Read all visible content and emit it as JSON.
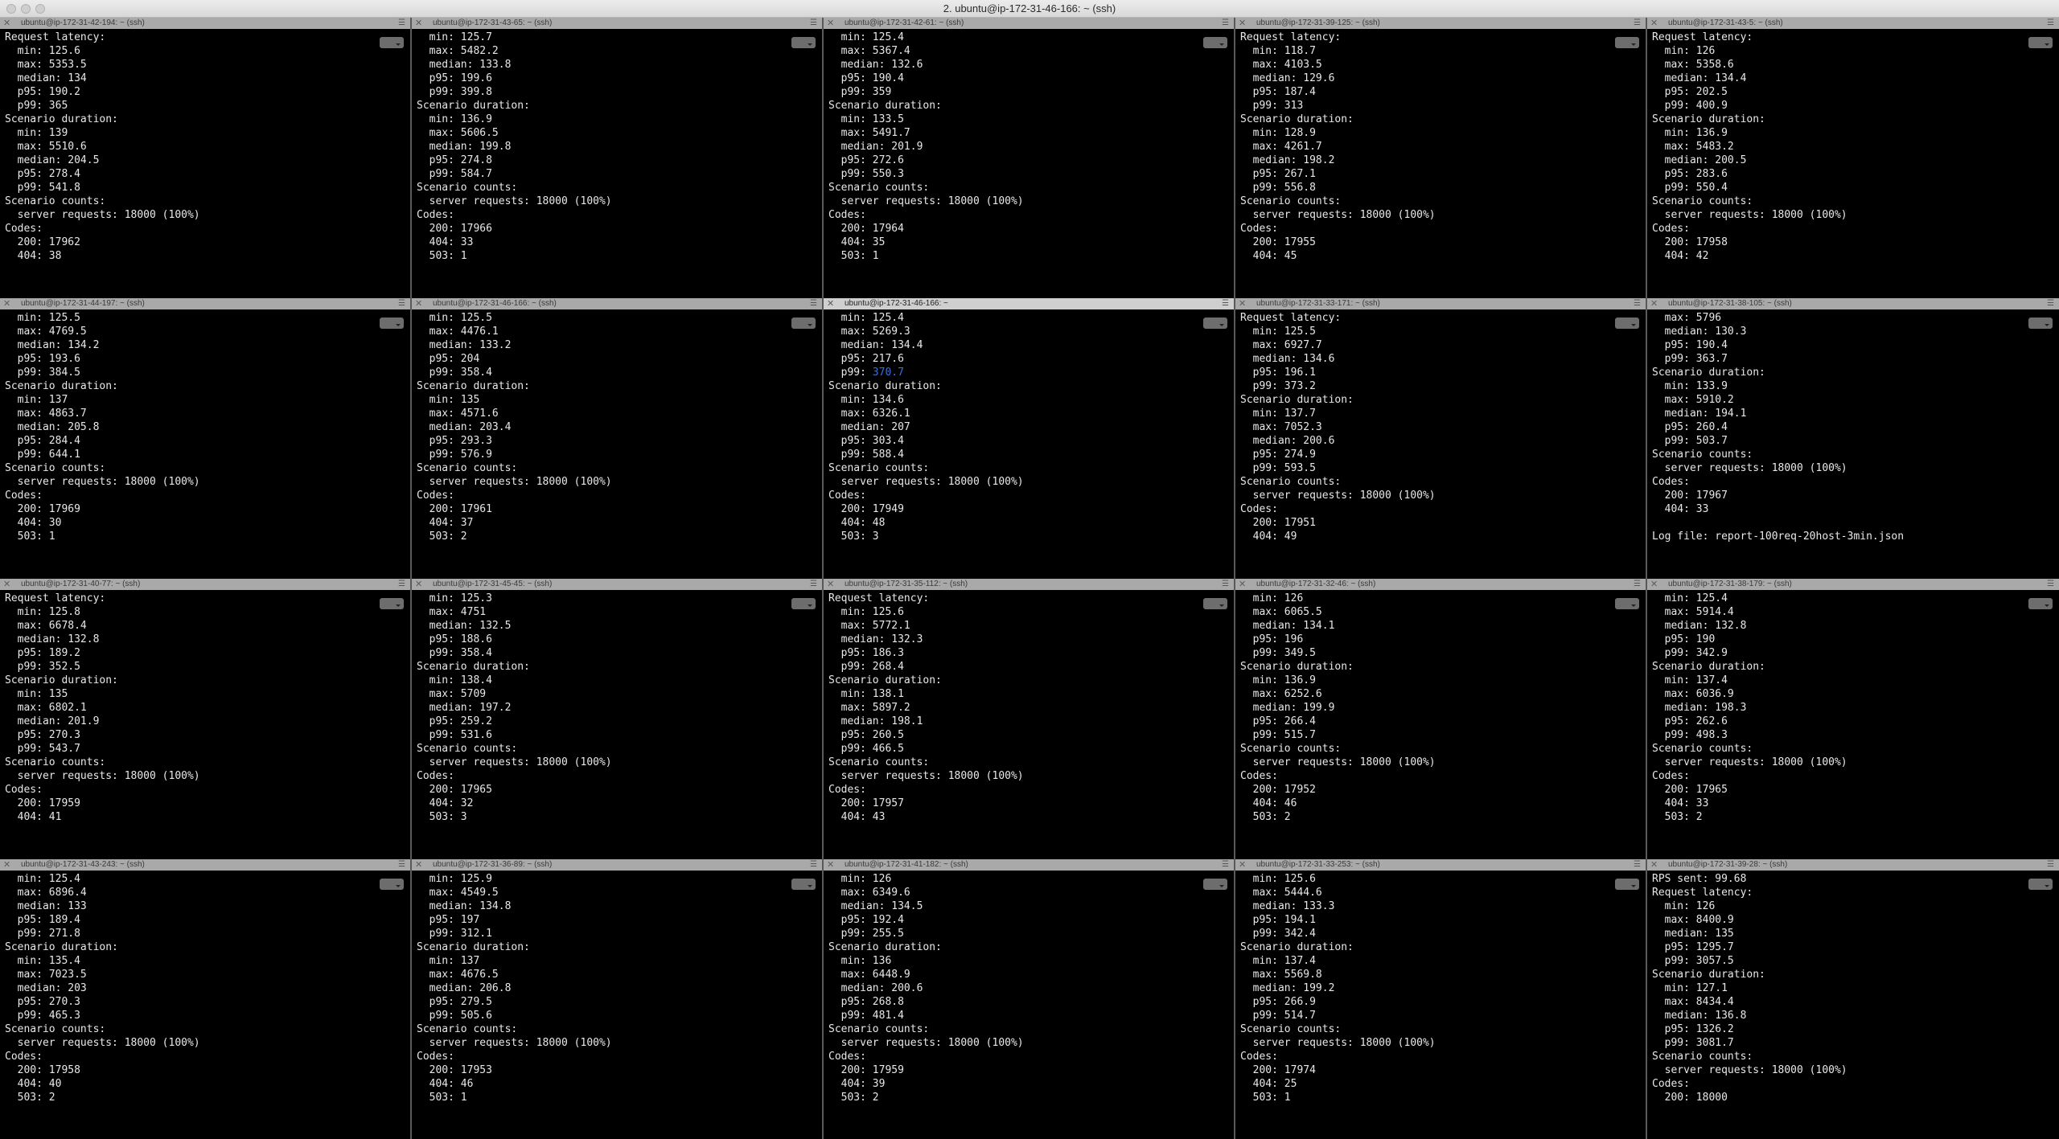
{
  "window": {
    "title": "2. ubuntu@ip-172-31-46-166: ~ (ssh)"
  },
  "panes": [
    {
      "title": "ubuntu@ip-172-31-42-194: ~ (ssh)",
      "lines": [
        "Request latency:",
        "  min: 125.6",
        "  max: 5353.5",
        "  median: 134",
        "  p95: 190.2",
        "  p99: 365",
        "Scenario duration:",
        "  min: 139",
        "  max: 5510.6",
        "  median: 204.5",
        "  p95: 278.4",
        "  p99: 541.8",
        "Scenario counts:",
        "  server requests: 18000 (100%)",
        "Codes:",
        "  200: 17962",
        "  404: 38"
      ]
    },
    {
      "title": "ubuntu@ip-172-31-43-65: ~ (ssh)",
      "lines": [
        "  min: 125.7",
        "  max: 5482.2",
        "  median: 133.8",
        "  p95: 199.6",
        "  p99: 399.8",
        "Scenario duration:",
        "  min: 136.9",
        "  max: 5606.5",
        "  median: 199.8",
        "  p95: 274.8",
        "  p99: 584.7",
        "Scenario counts:",
        "  server requests: 18000 (100%)",
        "Codes:",
        "  200: 17966",
        "  404: 33",
        "  503: 1"
      ]
    },
    {
      "title": "ubuntu@ip-172-31-42-61: ~ (ssh)",
      "lines": [
        "  min: 125.4",
        "  max: 5367.4",
        "  median: 132.6",
        "  p95: 190.4",
        "  p99: 359",
        "Scenario duration:",
        "  min: 133.5",
        "  max: 5491.7",
        "  median: 201.9",
        "  p95: 272.6",
        "  p99: 550.3",
        "Scenario counts:",
        "  server requests: 18000 (100%)",
        "Codes:",
        "  200: 17964",
        "  404: 35",
        "  503: 1"
      ]
    },
    {
      "title": "ubuntu@ip-172-31-39-125: ~ (ssh)",
      "lines": [
        "Request latency:",
        "  min: 118.7",
        "  max: 4103.5",
        "  median: 129.6",
        "  p95: 187.4",
        "  p99: 313",
        "Scenario duration:",
        "  min: 128.9",
        "  max: 4261.7",
        "  median: 198.2",
        "  p95: 267.1",
        "  p99: 556.8",
        "Scenario counts:",
        "  server requests: 18000 (100%)",
        "Codes:",
        "  200: 17955",
        "  404: 45"
      ]
    },
    {
      "title": "ubuntu@ip-172-31-43-5: ~ (ssh)",
      "lines": [
        "Request latency:",
        "  min: 126",
        "  max: 5358.6",
        "  median: 134.4",
        "  p95: 202.5",
        "  p99: 400.9",
        "Scenario duration:",
        "  min: 136.9",
        "  max: 5483.2",
        "  median: 200.5",
        "  p95: 283.6",
        "  p99: 550.4",
        "Scenario counts:",
        "  server requests: 18000 (100%)",
        "Codes:",
        "  200: 17958",
        "  404: 42"
      ]
    },
    {
      "title": "ubuntu@ip-172-31-44-197: ~ (ssh)",
      "lines": [
        "  min: 125.5",
        "  max: 4769.5",
        "  median: 134.2",
        "  p95: 193.6",
        "  p99: 384.5",
        "Scenario duration:",
        "  min: 137",
        "  max: 4863.7",
        "  median: 205.8",
        "  p95: 284.4",
        "  p99: 644.1",
        "Scenario counts:",
        "  server requests: 18000 (100%)",
        "Codes:",
        "  200: 17969",
        "  404: 30",
        "  503: 1"
      ]
    },
    {
      "title": "ubuntu@ip-172-31-46-166: ~ (ssh)",
      "lines": [
        "  min: 125.5",
        "  max: 4476.1",
        "  median: 133.2",
        "  p95: 204",
        "  p99: 358.4",
        "Scenario duration:",
        "  min: 135",
        "  max: 4571.6",
        "  median: 203.4",
        "  p95: 293.3",
        "  p99: 576.9",
        "Scenario counts:",
        "  server requests: 18000 (100%)",
        "Codes:",
        "  200: 17961",
        "  404: 37",
        "  503: 2"
      ]
    },
    {
      "title": "ubuntu@ip-172-31-46-166: ~",
      "active": true,
      "lines": [
        "  min: 125.4",
        "  max: 5269.3",
        "  median: 134.4",
        "  p95: 217.6",
        "  p99: 370.7",
        "Scenario duration:",
        "  min: 134.6",
        "  max: 6326.1",
        "  median: 207",
        "  p95: 303.4",
        "  p99: 588.4",
        "Scenario counts:",
        "  server requests: 18000 (100%)",
        "Codes:",
        "  200: 17949",
        "  404: 48",
        "  503: 3"
      ]
    },
    {
      "title": "ubuntu@ip-172-31-33-171: ~ (ssh)",
      "lines": [
        "Request latency:",
        "  min: 125.5",
        "  max: 6927.7",
        "  median: 134.6",
        "  p95: 196.1",
        "  p99: 373.2",
        "Scenario duration:",
        "  min: 137.7",
        "  max: 7052.3",
        "  median: 200.6",
        "  p95: 274.9",
        "  p99: 593.5",
        "Scenario counts:",
        "  server requests: 18000 (100%)",
        "Codes:",
        "  200: 17951",
        "  404: 49"
      ]
    },
    {
      "title": "ubuntu@ip-172-31-38-105: ~ (ssh)",
      "lines": [
        "  max: 5796",
        "  median: 130.3",
        "  p95: 190.4",
        "  p99: 363.7",
        "Scenario duration:",
        "  min: 133.9",
        "  max: 5910.2",
        "  median: 194.1",
        "  p95: 260.4",
        "  p99: 503.7",
        "Scenario counts:",
        "  server requests: 18000 (100%)",
        "Codes:",
        "  200: 17967",
        "  404: 33",
        "",
        "Log file: report-100req-20host-3min.json"
      ]
    },
    {
      "title": "ubuntu@ip-172-31-40-77: ~ (ssh)",
      "lines": [
        "Request latency:",
        "  min: 125.8",
        "  max: 6678.4",
        "  median: 132.8",
        "  p95: 189.2",
        "  p99: 352.5",
        "Scenario duration:",
        "  min: 135",
        "  max: 6802.1",
        "  median: 201.9",
        "  p95: 270.3",
        "  p99: 543.7",
        "Scenario counts:",
        "  server requests: 18000 (100%)",
        "Codes:",
        "  200: 17959",
        "  404: 41"
      ]
    },
    {
      "title": "ubuntu@ip-172-31-45-45: ~ (ssh)",
      "lines": [
        "  min: 125.3",
        "  max: 4751",
        "  median: 132.5",
        "  p95: 188.6",
        "  p99: 358.4",
        "Scenario duration:",
        "  min: 138.4",
        "  max: 5709",
        "  median: 197.2",
        "  p95: 259.2",
        "  p99: 531.6",
        "Scenario counts:",
        "  server requests: 18000 (100%)",
        "Codes:",
        "  200: 17965",
        "  404: 32",
        "  503: 3"
      ]
    },
    {
      "title": "ubuntu@ip-172-31-35-112: ~ (ssh)",
      "lines": [
        "Request latency:",
        "  min: 125.6",
        "  max: 5772.1",
        "  median: 132.3",
        "  p95: 186.3",
        "  p99: 268.4",
        "Scenario duration:",
        "  min: 138.1",
        "  max: 5897.2",
        "  median: 198.1",
        "  p95: 260.5",
        "  p99: 466.5",
        "Scenario counts:",
        "  server requests: 18000 (100%)",
        "Codes:",
        "  200: 17957",
        "  404: 43"
      ]
    },
    {
      "title": "ubuntu@ip-172-31-32-46: ~ (ssh)",
      "lines": [
        "  min: 126",
        "  max: 6065.5",
        "  median: 134.1",
        "  p95: 196",
        "  p99: 349.5",
        "Scenario duration:",
        "  min: 136.9",
        "  max: 6252.6",
        "  median: 199.9",
        "  p95: 266.4",
        "  p99: 515.7",
        "Scenario counts:",
        "  server requests: 18000 (100%)",
        "Codes:",
        "  200: 17952",
        "  404: 46",
        "  503: 2"
      ]
    },
    {
      "title": "ubuntu@ip-172-31-38-179: ~ (ssh)",
      "lines": [
        "  min: 125.4",
        "  max: 5914.4",
        "  median: 132.8",
        "  p95: 190",
        "  p99: 342.9",
        "Scenario duration:",
        "  min: 137.4",
        "  max: 6036.9",
        "  median: 198.3",
        "  p95: 262.6",
        "  p99: 498.3",
        "Scenario counts:",
        "  server requests: 18000 (100%)",
        "Codes:",
        "  200: 17965",
        "  404: 33",
        "  503: 2"
      ]
    },
    {
      "title": "ubuntu@ip-172-31-43-243: ~ (ssh)",
      "lines": [
        "  min: 125.4",
        "  max: 6896.4",
        "  median: 133",
        "  p95: 189.4",
        "  p99: 271.8",
        "Scenario duration:",
        "  min: 135.4",
        "  max: 7023.5",
        "  median: 203",
        "  p95: 270.3",
        "  p99: 465.3",
        "Scenario counts:",
        "  server requests: 18000 (100%)",
        "Codes:",
        "  200: 17958",
        "  404: 40",
        "  503: 2"
      ]
    },
    {
      "title": "ubuntu@ip-172-31-36-89: ~ (ssh)",
      "lines": [
        "  min: 125.9",
        "  max: 4549.5",
        "  median: 134.8",
        "  p95: 197",
        "  p99: 312.1",
        "Scenario duration:",
        "  min: 137",
        "  max: 4676.5",
        "  median: 206.8",
        "  p95: 279.5",
        "  p99: 505.6",
        "Scenario counts:",
        "  server requests: 18000 (100%)",
        "Codes:",
        "  200: 17953",
        "  404: 46",
        "  503: 1"
      ]
    },
    {
      "title": "ubuntu@ip-172-31-41-182: ~ (ssh)",
      "lines": [
        "  min: 126",
        "  max: 6349.6",
        "  median: 134.5",
        "  p95: 192.4",
        "  p99: 255.5",
        "Scenario duration:",
        "  min: 136",
        "  max: 6448.9",
        "  median: 200.6",
        "  p95: 268.8",
        "  p99: 481.4",
        "Scenario counts:",
        "  server requests: 18000 (100%)",
        "Codes:",
        "  200: 17959",
        "  404: 39",
        "  503: 2"
      ]
    },
    {
      "title": "ubuntu@ip-172-31-33-253: ~ (ssh)",
      "lines": [
        "  min: 125.6",
        "  max: 5444.6",
        "  median: 133.3",
        "  p95: 194.1",
        "  p99: 342.4",
        "Scenario duration:",
        "  min: 137.4",
        "  max: 5569.8",
        "  median: 199.2",
        "  p95: 266.9",
        "  p99: 514.7",
        "Scenario counts:",
        "  server requests: 18000 (100%)",
        "Codes:",
        "  200: 17974",
        "  404: 25",
        "  503: 1"
      ]
    },
    {
      "title": "ubuntu@ip-172-31-39-28: ~ (ssh)",
      "lines": [
        "RPS sent: 99.68",
        "Request latency:",
        "  min: 126",
        "  max: 8400.9",
        "  median: 135",
        "  p95: 1295.7",
        "  p99: 3057.5",
        "Scenario duration:",
        "  min: 127.1",
        "  max: 8434.4",
        "  median: 136.8",
        "  p95: 1326.2",
        "  p99: 3081.7",
        "Scenario counts:",
        "  server requests: 18000 (100%)",
        "Codes:",
        "  200: 18000"
      ]
    }
  ]
}
